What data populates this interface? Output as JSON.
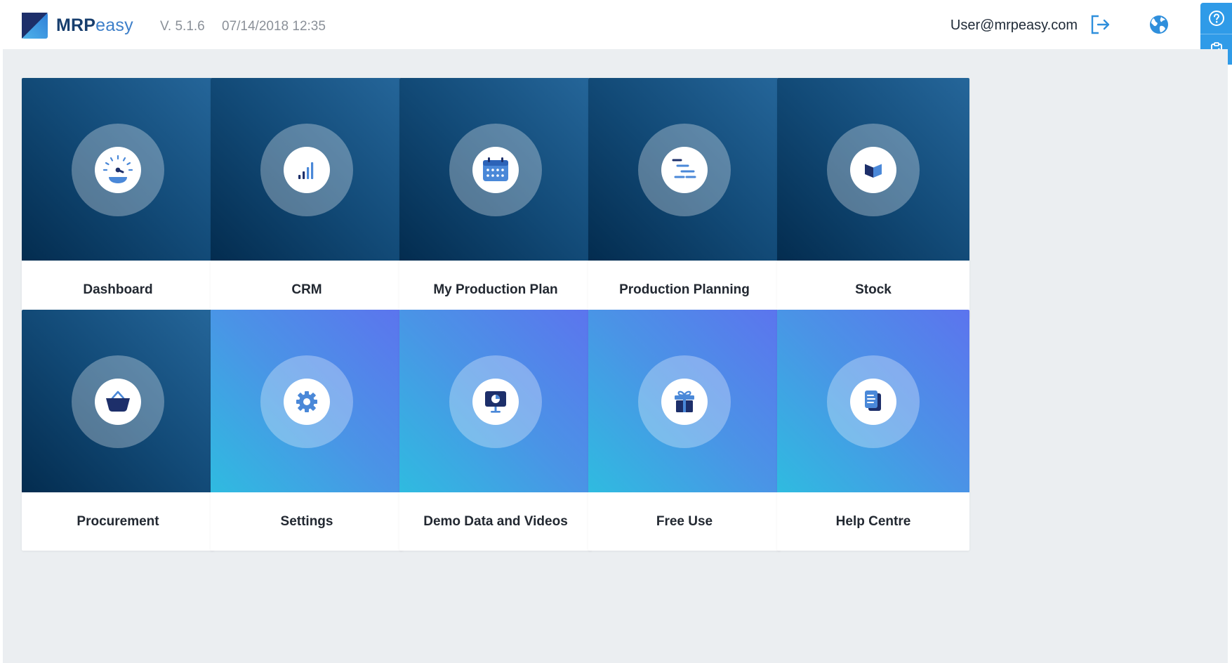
{
  "header": {
    "logo": {
      "mrp": "MRP",
      "easy": "easy"
    },
    "version": "V. 5.1.6",
    "datetime": "07/14/2018 12:35",
    "user_email": "User@mrpeasy.com",
    "icons": {
      "logout": "logout-icon",
      "globe": "globe-icon"
    }
  },
  "side_panel": {
    "icons": [
      "help-icon",
      "clipboard-check-icon"
    ]
  },
  "tiles": [
    {
      "label": "Dashboard",
      "icon": "speedometer-icon",
      "style": "dark"
    },
    {
      "label": "CRM",
      "icon": "signal-bars-icon",
      "style": "dark"
    },
    {
      "label": "My Production Plan",
      "icon": "calendar-icon",
      "style": "dark"
    },
    {
      "label": "Production Planning",
      "icon": "gantt-lines-icon",
      "style": "dark"
    },
    {
      "label": "Stock",
      "icon": "box-icon",
      "style": "dark"
    },
    {
      "label": "Procurement",
      "icon": "basket-icon",
      "style": "dark"
    },
    {
      "label": "Settings",
      "icon": "gear-icon",
      "style": "light"
    },
    {
      "label": "Demo Data and Videos",
      "icon": "presentation-icon",
      "style": "light"
    },
    {
      "label": "Free Use",
      "icon": "gift-icon",
      "style": "light"
    },
    {
      "label": "Help Centre",
      "icon": "document-icon",
      "style": "light"
    }
  ],
  "colors": {
    "brand_dark": "#173e6e",
    "brand_light": "#3d7fc9",
    "accent_blue": "#2f9be8",
    "tile_dark": "#0b3a63",
    "tile_light": "#4a94e6",
    "background": "#ebeef1"
  }
}
